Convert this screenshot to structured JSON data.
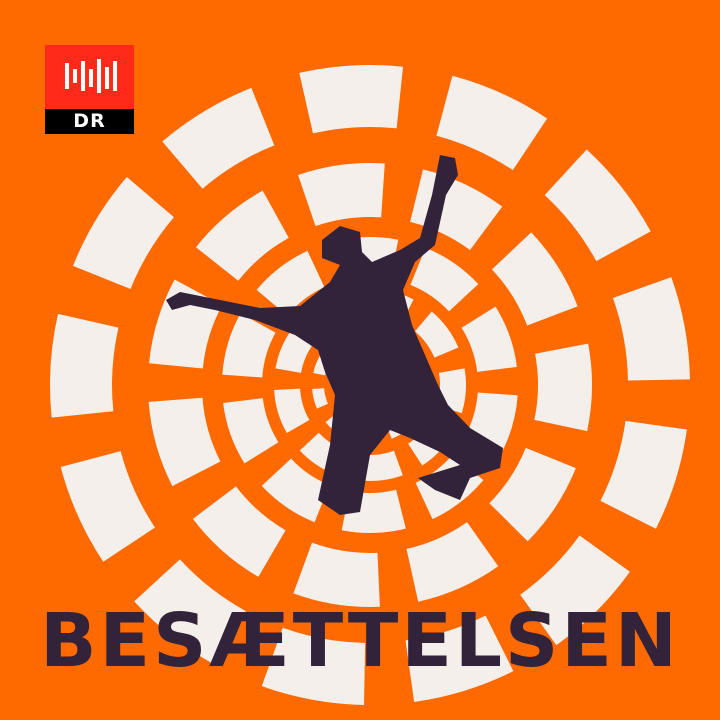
{
  "logo": {
    "brand": "DR"
  },
  "title": "BESÆTTELSEN",
  "colors": {
    "background": "#ff6a00",
    "spiral": "#f4efeb",
    "silhouette": "#33233a",
    "logo_red": "#ff2a1a",
    "logo_black": "#000000"
  }
}
